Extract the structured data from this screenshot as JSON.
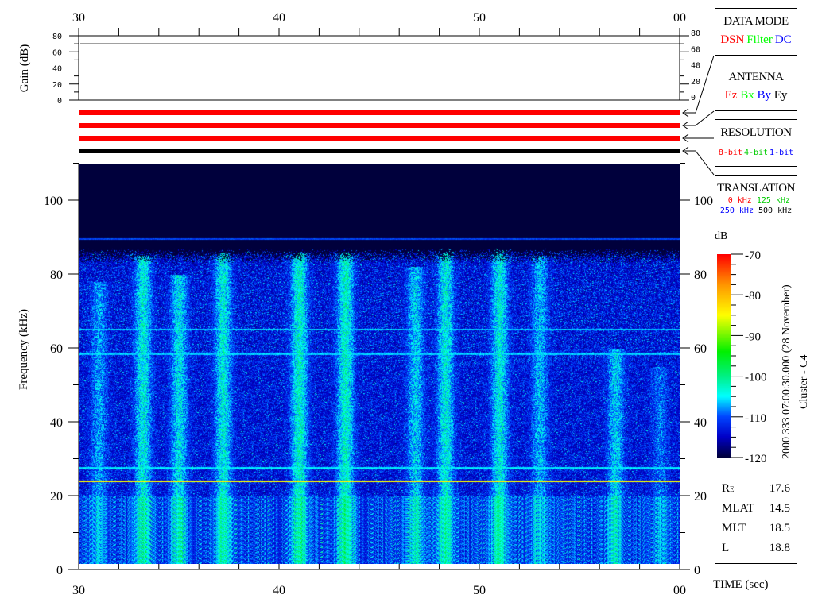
{
  "chart_data": {
    "type": "heatmap",
    "title": "Cluster - C4",
    "date_label": "2000 333 07:00:30.000 (28 November)",
    "xlabel": "TIME (sec)",
    "ylabel": "Frequency (kHz)",
    "x_ticks": [
      "30",
      "40",
      "50",
      "00"
    ],
    "x_range_sec": [
      30,
      60
    ],
    "y_range_khz": [
      0,
      110
    ],
    "y_ticks": [
      "0",
      "20",
      "40",
      "60",
      "80",
      "100"
    ],
    "colorbar": {
      "label": "dB",
      "range": [
        -120,
        -70
      ],
      "ticks": [
        "-70",
        "-80",
        "-90",
        "-100",
        "-110",
        "-120"
      ]
    },
    "emission_upper_cutoff_khz": 85,
    "interference_lines": [
      {
        "freq_khz": 89.5,
        "level_db": -112
      },
      {
        "freq_khz": 65,
        "level_db": -108
      },
      {
        "freq_khz": 58.5,
        "level_db": -108
      },
      {
        "freq_khz": 27.5,
        "level_db": -107
      },
      {
        "freq_khz": 24,
        "level_db": -86
      }
    ],
    "bursts": [
      {
        "t": 31,
        "f_top": 78,
        "level_db": -108
      },
      {
        "t": 33.2,
        "f_top": 85,
        "level_db": -104
      },
      {
        "t": 35,
        "f_top": 80,
        "level_db": -105
      },
      {
        "t": 37.2,
        "f_top": 86,
        "level_db": -104
      },
      {
        "t": 41,
        "f_top": 86,
        "level_db": -103
      },
      {
        "t": 43.3,
        "f_top": 86,
        "level_db": -103
      },
      {
        "t": 46.8,
        "f_top": 82,
        "level_db": -106
      },
      {
        "t": 48.3,
        "f_top": 88,
        "level_db": -104
      },
      {
        "t": 51,
        "f_top": 87,
        "level_db": -104
      },
      {
        "t": 53,
        "f_top": 85,
        "level_db": -107
      },
      {
        "t": 56.8,
        "f_top": 60,
        "level_db": -106
      },
      {
        "t": 59,
        "f_top": 55,
        "level_db": -110
      }
    ],
    "gain": {
      "ylabel": "Gain (dB)",
      "y_ticks": [
        "0",
        "20",
        "40",
        "60",
        "80"
      ],
      "y_range": [
        0,
        80
      ],
      "value_db": 70
    },
    "status_bars": [
      {
        "color": "#ff0000"
      },
      {
        "color": "#ff0000"
      },
      {
        "color": "#ff0000"
      },
      {
        "color": "#000000"
      }
    ]
  },
  "panels": {
    "data_mode": {
      "title": "DATA MODE",
      "options": [
        {
          "label": "DSN",
          "color": "#ff0000"
        },
        {
          "label": "Filter",
          "color": "#00ff00"
        },
        {
          "label": "DC",
          "color": "#0000ff"
        }
      ]
    },
    "antenna": {
      "title": "ANTENNA",
      "options": [
        {
          "label": "Ez",
          "color": "#ff0000"
        },
        {
          "label": "Bx",
          "color": "#00ff00"
        },
        {
          "label": "By",
          "color": "#0000ff"
        },
        {
          "label": "Ey",
          "color": "#000000"
        }
      ]
    },
    "resolution": {
      "title": "RESOLUTION",
      "options": [
        {
          "label": "8-bit",
          "color": "#ff0000"
        },
        {
          "label": "4-bit",
          "color": "#00ff00"
        },
        {
          "label": "1-bit",
          "color": "#0000ff"
        }
      ]
    },
    "translation": {
      "title": "TRANSLATION",
      "options": [
        {
          "label": "0 kHz",
          "color": "#ff0000"
        },
        {
          "label": "125 kHz",
          "color": "#00ff00"
        },
        {
          "label": "250 kHz",
          "color": "#0000ff"
        },
        {
          "label": "500 kHz",
          "color": "#000000"
        }
      ]
    }
  },
  "orbit": {
    "re_label": "R",
    "re_sub": "E",
    "re_value": "17.6",
    "mlat_label": "MLAT",
    "mlat_value": "14.5",
    "mlt_label": "MLT",
    "mlt_value": "18.5",
    "l_label": "L",
    "l_value": "18.8"
  }
}
